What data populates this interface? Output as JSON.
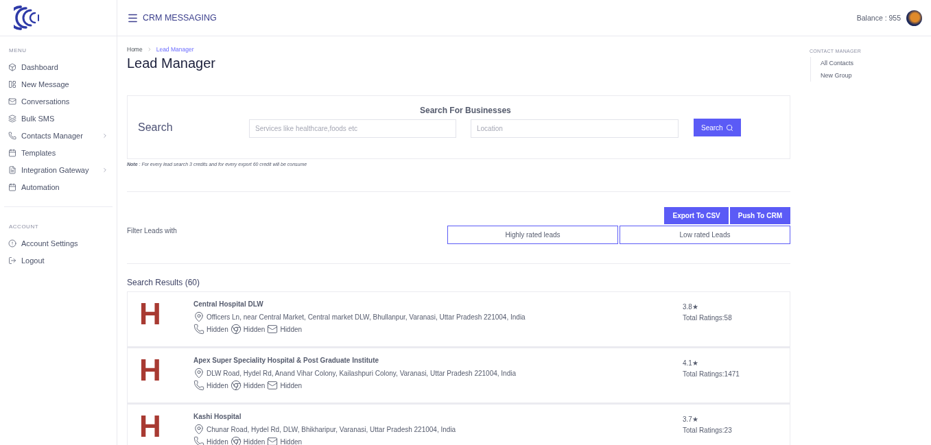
{
  "header": {
    "title": "CRM MESSAGING",
    "balance": "Balance : 955"
  },
  "sidebar": {
    "sections": [
      {
        "title": "MENU",
        "items": [
          {
            "label": "Dashboard",
            "submenu": false
          },
          {
            "label": "New Message",
            "submenu": false
          },
          {
            "label": "Conversations",
            "submenu": false
          },
          {
            "label": "Bulk SMS",
            "submenu": false
          },
          {
            "label": "Contacts Manager",
            "submenu": true
          },
          {
            "label": "Templates",
            "submenu": false
          },
          {
            "label": "Integration Gateway",
            "submenu": true
          },
          {
            "label": "Automation",
            "submenu": false
          }
        ]
      },
      {
        "title": "ACCOUNT",
        "items": [
          {
            "label": "Account Settings",
            "submenu": false
          },
          {
            "label": "Logout",
            "submenu": false
          }
        ]
      }
    ]
  },
  "breadcrumb": [
    {
      "label": "Home",
      "selected": false
    },
    {
      "label": "Lead Manager",
      "selected": true
    }
  ],
  "page_title": "Lead Manager",
  "search": {
    "heading": "Search",
    "subheading": "Search For Businesses",
    "service_placeholder": "Services like healthcare,foods etc",
    "location_placeholder": "Location",
    "button": "Search"
  },
  "note": "**Note** : For every lead search 3 credits and for every export 60 credit will be consume",
  "actions": [
    "Export To CSV",
    "Push To CRM"
  ],
  "filter": {
    "label": "Filter Leads with",
    "options": [
      {
        "label": "Highly rated leads",
        "selected": false
      },
      {
        "label": "Low rated Leads",
        "selected": false
      }
    ]
  },
  "results": {
    "title": "Search Results (60)",
    "items": [
      {
        "letter": "H",
        "name": "Central Hospital DLW",
        "address": "Officers Ln, near Central Market, Central market DLW, Bhullanpur, Varanasi, Uttar Pradesh 221004, India",
        "phone": "Hidden",
        "website": "Hidden",
        "email": "Hidden",
        "rating": "3.8★",
        "total": "Total Ratings:58"
      },
      {
        "letter": "H",
        "name": "Apex Super Speciality Hospital & Post Graduate Institute",
        "address": "DLW Road, Hydel Rd, Anand Vihar Colony, Kailashpuri Colony, Varanasi, Uttar Pradesh 221004, India",
        "phone": "Hidden",
        "website": "Hidden",
        "email": "Hidden",
        "rating": "4.1★",
        "total": "Total Ratings:1471"
      },
      {
        "letter": "H",
        "name": "Kashi Hospital",
        "address": "Chunar Road, Hydel Rd, DLW, Bhikharipur, Varanasi, Uttar Pradesh 221004, India",
        "phone": "Hidden",
        "website": "Hidden",
        "email": "Hidden",
        "rating": "3.7★",
        "total": "Total Ratings:23"
      }
    ]
  },
  "right_panel": {
    "title": "CONTACT MANAGER",
    "items": [
      "All Contacts",
      "New Group"
    ]
  }
}
